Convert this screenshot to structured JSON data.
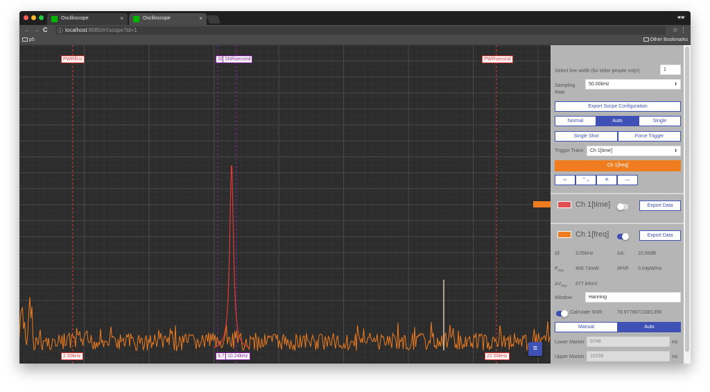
{
  "browser": {
    "tabs": [
      {
        "title": "Oscilloscope",
        "close": "×"
      },
      {
        "title": "Oscilloscope",
        "close": "×"
      }
    ],
    "nav": {
      "back": "←",
      "forward": "→",
      "reload": "C"
    },
    "url_host": "localhost",
    "url_rest": ":8080/#!/scope?id=1",
    "star": "☆",
    "menu": "⋮",
    "incognito": "🕶",
    "bookmarks": {
      "left": "p5",
      "right": "Other Bookmarks"
    }
  },
  "scope": {
    "markers_top": [
      {
        "text": "PWRfirst"
      },
      {
        "text": "Sl"
      },
      {
        "text": "SNRsecond"
      },
      {
        "text": "PWRsecond"
      }
    ],
    "markers_bottom": [
      {
        "text": "2.50kHz"
      },
      {
        "text": "9.7:"
      },
      {
        "text": "10.24kHz"
      },
      {
        "text": "22.50kHz"
      }
    ],
    "fab_icon": "≡",
    "colors": {
      "background": "#2c2c2c",
      "grid": "#4a4a4a",
      "trace": "#ef7d20",
      "peak": "#e53935",
      "marker_red": "#e53935",
      "marker_purple": "#8e24aa"
    }
  },
  "panel": {
    "line_width_label": "Select line width (for elder people only!)",
    "line_width_value": "1",
    "sampling_label": "Sampling Rate",
    "sampling_value": "50.00kHz",
    "export_config": "Export Socpe Configuration",
    "mode_buttons": {
      "normal": "Normal",
      "auto": "Auto",
      "single": "Single"
    },
    "single_shot": "Single Shot",
    "force_trigger": "Force Trigger",
    "trigger_trace_label": "Trigger Trace",
    "trigger_trace_value": "Ch 1[time]",
    "active_trace": "Ch 1[freq]",
    "tools": {
      "horizontal": "‹›",
      "vertical": "⌃⌄",
      "plus": "+",
      "minus": "—"
    },
    "ch_time": {
      "name": "Ch 1[time]",
      "export": "Export Data",
      "color": "#e05050"
    },
    "ch_freq": {
      "name": "Ch 1[freq]",
      "export": "Export Data",
      "color": "#ef7d20"
    },
    "measurements": {
      "df_label": "Δf:",
      "df_value": "3.05kHz",
      "dA_label": "ΔA:",
      "dA_value": "10.00dB",
      "prms_label": "P",
      "prms_sub": "rms",
      "prms_value": "459.73mW",
      "dpdf_label": "∂P/∂f:",
      "dpdf_value": "0.04pW/Hz",
      "vrms_label": "ΔV",
      "vrms_sub": "rms",
      "vrms_value": "677.84mV"
    },
    "window_label": "Window",
    "window_value": "Hanning",
    "snr_label": "Calculate SNR:",
    "snr_value": "78.97798713381356",
    "snr_mode": {
      "manual": "Manual",
      "auto": "Auto"
    },
    "lower_marker_label": "Lower Marker",
    "lower_marker_value": "9748",
    "upper_marker_label": "Upper Marker",
    "upper_marker_value": "10236",
    "hz": "Hz",
    "accent": "#3f51b5"
  }
}
